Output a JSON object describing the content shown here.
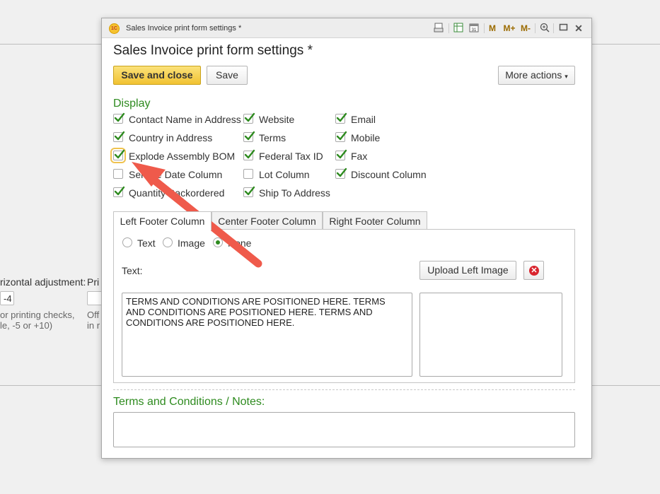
{
  "background": {
    "label_horizontal": "rizontal adjustment:",
    "label_pri": "Pri",
    "value_offset": "-4",
    "hint_line1": "or printing checks,",
    "hint_line2": "le, -5 or +10)",
    "hint2_line1": "Off",
    "hint2_line2": "in r"
  },
  "window": {
    "title": "Sales Invoice print form settings *",
    "logo": "1C",
    "toolbar": {
      "m": "M",
      "m_plus": "M+",
      "m_minus": "M-",
      "close": "✕"
    }
  },
  "form": {
    "title": "Sales Invoice print form settings *",
    "save_and_close": "Save and close",
    "save": "Save",
    "more_actions": "More actions"
  },
  "display": {
    "heading": "Display",
    "checkboxes": [
      {
        "label": "Contact Name in Address",
        "checked": true
      },
      {
        "label": "Website",
        "checked": true
      },
      {
        "label": "Email",
        "checked": true
      },
      {
        "label": "Country in Address",
        "checked": true
      },
      {
        "label": "Terms",
        "checked": true
      },
      {
        "label": "Mobile",
        "checked": true
      },
      {
        "label": "Explode Assembly BOM",
        "checked": true
      },
      {
        "label": "Federal Tax ID",
        "checked": true
      },
      {
        "label": "Fax",
        "checked": true
      },
      {
        "label": "Service Date Column",
        "checked": false
      },
      {
        "label": "Lot Column",
        "checked": false
      },
      {
        "label": "Discount Column",
        "checked": true
      },
      {
        "label": "Quantity Backordered",
        "checked": true
      },
      {
        "label": "Ship To Address",
        "checked": true
      }
    ]
  },
  "footer_tabs": [
    "Left Footer Column",
    "Center Footer Column",
    "Right Footer Column"
  ],
  "left_footer": {
    "radios": [
      "Text",
      "Image",
      "None"
    ],
    "selected": "None",
    "text_label": "Text:",
    "upload_button": "Upload Left Image",
    "text_value": "TERMS AND CONDITIONS ARE POSITIONED HERE. TERMS\nAND CONDITIONS ARE POSITIONED HERE. TERMS AND\nCONDITIONS ARE POSITIONED HERE."
  },
  "terms": {
    "heading": "Terms and Conditions / Notes:",
    "value": ""
  },
  "colors": {
    "accent_green": "#2e8b1f",
    "primary_button": "#f1c232",
    "arrow": "#ef5a4b"
  }
}
